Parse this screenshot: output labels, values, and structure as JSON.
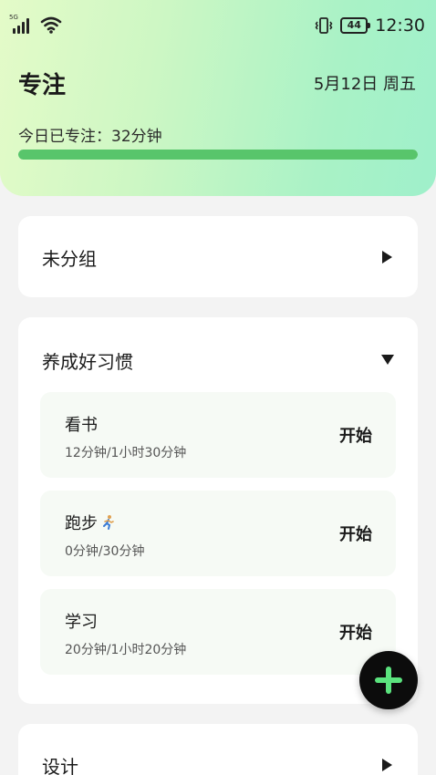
{
  "status_bar": {
    "network_tag": "5G",
    "time": "12:30",
    "battery": "44",
    "icons": [
      "signal-icon",
      "wifi-icon",
      "vibrate-icon",
      "battery-icon"
    ]
  },
  "header": {
    "title": "专注",
    "date": "5月12日 周五",
    "today_focus": "今日已专注：32分钟",
    "progress": 1.0
  },
  "groups": [
    {
      "name": "未分组",
      "expanded": false,
      "icon": "triangle-right-icon"
    },
    {
      "name": "养成好习惯",
      "expanded": true,
      "icon": "triangle-down-icon",
      "habits": [
        {
          "name": "看书",
          "time": "12分钟/1小时30分钟",
          "action": "开始"
        },
        {
          "name": "跑步",
          "emoji_icon": "runner-icon",
          "time": "0分钟/30分钟",
          "action": "开始"
        },
        {
          "name": "学习",
          "time": "20分钟/1小时20分钟",
          "action": "开始"
        }
      ]
    },
    {
      "name": "设计",
      "expanded": false,
      "icon": "triangle-right-icon"
    }
  ],
  "fab": {
    "icon": "plus-icon"
  },
  "colors": {
    "accent": "#58c56b",
    "fab_bg": "#0c0c0c",
    "fab_plus": "#5be37e",
    "header_gradient_start": "#e4fbc8",
    "header_gradient_end": "#9ff0cb"
  }
}
